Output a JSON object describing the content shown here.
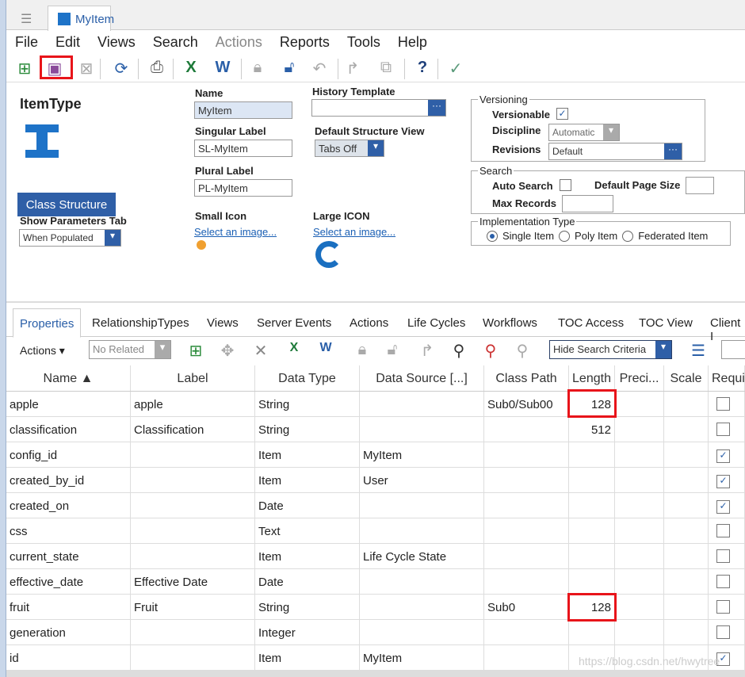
{
  "window": {
    "tab_title": "MyItem"
  },
  "menu": [
    "File",
    "Edit",
    "Views",
    "Search",
    "Actions",
    "Reports",
    "Tools",
    "Help"
  ],
  "toolbar_icons": [
    "new-icon",
    "save-icon",
    "delete-icon",
    "refresh-icon",
    "print-icon",
    "excel-icon",
    "word-icon",
    "lock-icon",
    "unlock-icon",
    "undo-icon",
    "promote-icon",
    "copy-icon",
    "help-icon",
    "done-icon"
  ],
  "form": {
    "item_type_label": "ItemType",
    "class_structure_button": "Class Structure",
    "show_params_label": "Show Parameters Tab",
    "show_params_value": "When Populated",
    "name_label": "Name",
    "name_value": "MyItem",
    "singular_label": "Singular Label",
    "singular_value": "SL-MyItem",
    "plural_label": "Plural Label",
    "plural_value": "PL-MyItem",
    "small_icon_label": "Small Icon",
    "small_icon_link": "Select an image...",
    "history_label": "History Template",
    "history_value": "",
    "default_view_label": "Default Structure View",
    "default_view_value": "Tabs Off",
    "large_icon_label": "Large ICON",
    "large_icon_link": "Select an image...",
    "versioning": {
      "legend": "Versioning",
      "versionable_label": "Versionable",
      "versionable": true,
      "discipline_label": "Discipline",
      "discipline_value": "Automatic",
      "revisions_label": "Revisions",
      "revisions_value": "Default"
    },
    "search": {
      "legend": "Search",
      "auto_search_label": "Auto Search",
      "auto_search": false,
      "page_size_label": "Default Page Size",
      "page_size_value": "",
      "max_records_label": "Max Records",
      "max_records_value": ""
    },
    "implementation": {
      "legend": "Implementation Type",
      "options": [
        "Single Item",
        "Poly Item",
        "Federated Item"
      ],
      "selected": "Single Item"
    }
  },
  "tabs": [
    "Properties",
    "RelationshipTypes",
    "Views",
    "Server Events",
    "Actions",
    "Life Cycles",
    "Workflows",
    "TOC Access",
    "TOC View",
    "Client I"
  ],
  "active_tab": "Properties",
  "grid_toolbar": {
    "actions_label": "Actions ▾",
    "related_value": "No Related",
    "search_criteria_value": "Hide Search Criteria"
  },
  "columns": [
    "Name ▲",
    "Label",
    "Data Type",
    "Data Source [...]",
    "Class Path",
    "Length",
    "Preci...",
    "Scale",
    "Requi"
  ],
  "rows": [
    [
      "apple",
      "apple",
      "String",
      "",
      "Sub0/Sub00",
      "128",
      "",
      "",
      false
    ],
    [
      "classification",
      "Classification",
      "String",
      "",
      "",
      "512",
      "",
      "",
      false
    ],
    [
      "config_id",
      "",
      "Item",
      "MyItem",
      "",
      "",
      "",
      "",
      true
    ],
    [
      "created_by_id",
      "",
      "Item",
      "User",
      "",
      "",
      "",
      "",
      true
    ],
    [
      "created_on",
      "",
      "Date",
      "",
      "",
      "",
      "",
      "",
      true
    ],
    [
      "css",
      "",
      "Text",
      "",
      "",
      "",
      "",
      "",
      false
    ],
    [
      "current_state",
      "",
      "Item",
      "Life Cycle State",
      "",
      "",
      "",
      "",
      false
    ],
    [
      "effective_date",
      "Effective Date",
      "Date",
      "",
      "",
      "",
      "",
      "",
      false
    ],
    [
      "fruit",
      "Fruit",
      "String",
      "",
      "Sub0",
      "128",
      "",
      "",
      false
    ],
    [
      "generation",
      "",
      "Integer",
      "",
      "",
      "",
      "",
      "",
      false
    ],
    [
      "id",
      "",
      "Item",
      "MyItem",
      "",
      "",
      "",
      "",
      true
    ]
  ],
  "watermark": "https://blog.csdn.net/hwytree"
}
